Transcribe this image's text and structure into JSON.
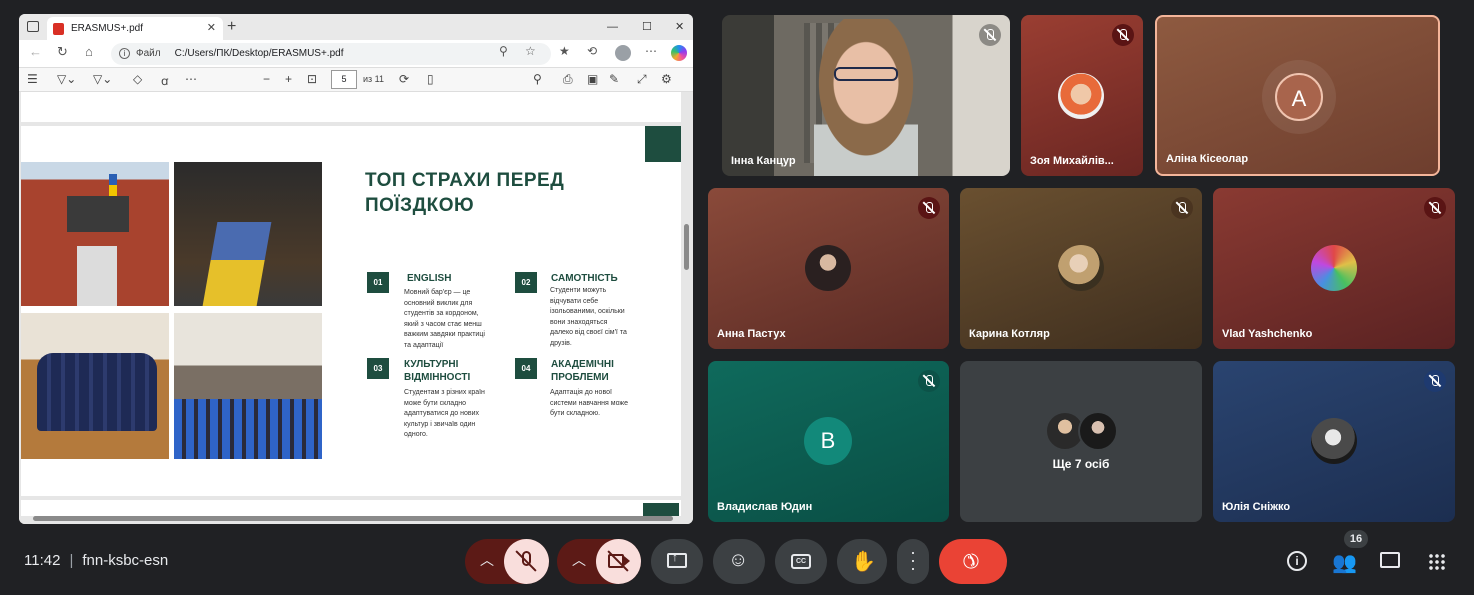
{
  "browser": {
    "tab_title": "ERASMUS+.pdf",
    "url_site": "Файл",
    "url_path": "C:/Users/ПК/Desktop/ERASMUS+.pdf",
    "page_current": "5",
    "page_total": "из 11"
  },
  "slide": {
    "title": "ТОП СТРАХИ ПЕРЕД ПОЇЗДКОЮ",
    "items": [
      {
        "num": "01",
        "title": "ENGLISH",
        "text": "Мовний бар'єр — це основний виклик для студентів за кордоном, який з часом стає менш важким завдяки практиці та адаптації"
      },
      {
        "num": "02",
        "title": "САМОТНІСТЬ",
        "text": "Студенти можуть відчувати себе ізольованими, оскільки вони знаходяться далеко від своєї сім'ї та друзів."
      },
      {
        "num": "03",
        "title": "КУЛЬТУРНІ ВІДМІННОСТІ",
        "text": "Студентам з різних країн може бути складно адаптуватися до нових культур і звичаїв один одного."
      },
      {
        "num": "04",
        "title": "АКАДЕМІЧНІ ПРОБЛЕМИ",
        "text": "Адаптація до нової системи навчання може бути складною."
      }
    ]
  },
  "participants": {
    "inna": "Інна Канцур",
    "zoya": "Зоя Михайлів...",
    "alina": "Аліна Кісеолар",
    "alina_initial": "A",
    "anna": "Анна Пастух",
    "karyna": "Карина Котляр",
    "vlad": "Vlad Yashchenko",
    "vladyslav": "Владислав Юдин",
    "vladyslav_initial": "B",
    "others": "Ще 7 осіб",
    "yuliia": "Юлія Сніжко"
  },
  "meeting": {
    "time": "11:42",
    "code": "fnn-ksbc-esn",
    "people_count": "16"
  },
  "colors": {
    "slide_accent": "#1e4d3f",
    "leave_button": "#ea4335",
    "mic_off_tint": "#f9dedc"
  }
}
